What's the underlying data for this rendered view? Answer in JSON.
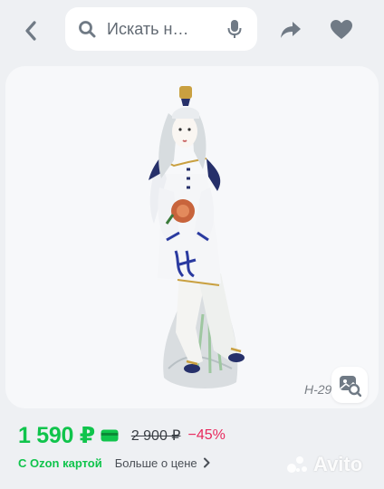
{
  "search": {
    "placeholder": "Искать н…"
  },
  "product": {
    "sku_label": "H-29"
  },
  "price": {
    "current": "1 590 ₽",
    "old": "2 900 ₽",
    "discount": "−45%",
    "ozon_card_label": "С Ozon картой",
    "more_price_label": "Больше о цене"
  },
  "watermark": {
    "text": "Avito"
  },
  "icons": {
    "back": "chevron-left-icon",
    "search": "search-icon",
    "mic": "microphone-icon",
    "share": "share-icon",
    "favorite": "heart-icon",
    "lens": "image-search-icon",
    "card": "ozon-card-icon",
    "chevron": "chevron-right-icon"
  },
  "colors": {
    "accent_green": "#10c44c",
    "discount_red": "#e8285c",
    "icon_gray": "#707a85",
    "background": "#eef0f3"
  }
}
